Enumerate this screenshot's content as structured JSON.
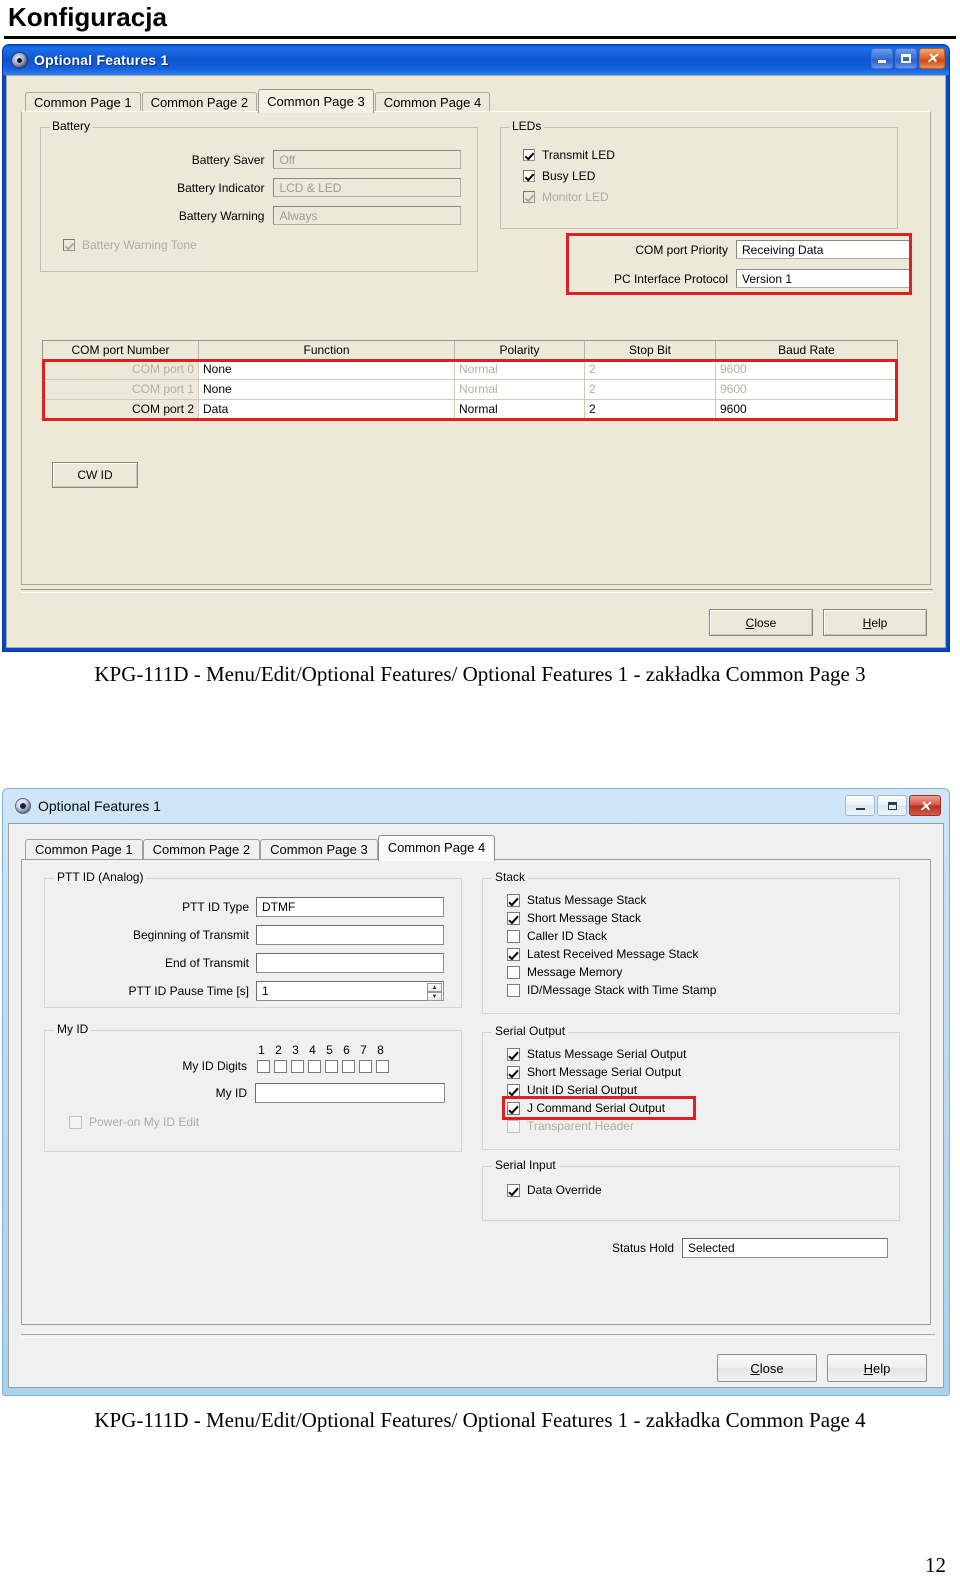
{
  "page": {
    "heading": "Konfiguracja",
    "page_number": "12",
    "caption_1": "KPG-111D - Menu/Edit/Optional Features/ Optional Features 1 - zakładka Common Page 3",
    "caption_2": "KPG-111D - Menu/Edit/Optional Features/ Optional Features 1 - zakładka Common Page 4",
    "highlight_color": "#e02020"
  },
  "window1": {
    "title": "Optional Features 1",
    "icon": "app-disc-icon",
    "controls": {
      "minimize": "–",
      "maximize": "□",
      "close": "✕"
    },
    "tabs": [
      {
        "label": "Common Page 1",
        "active": false
      },
      {
        "label": "Common Page 2",
        "active": false
      },
      {
        "label": "Common Page 3",
        "active": true
      },
      {
        "label": "Common Page 4",
        "active": false
      }
    ],
    "battery": {
      "legend": "Battery",
      "fields": [
        {
          "label": "Battery Saver",
          "value": "Off"
        },
        {
          "label": "Battery Indicator",
          "value": "LCD & LED"
        },
        {
          "label": "Battery Warning",
          "value": "Always"
        }
      ],
      "tone_checkbox": {
        "label": "Battery Warning Tone",
        "checked": true,
        "enabled": false
      }
    },
    "leds": {
      "legend": "LEDs",
      "items": [
        {
          "label": "Transmit LED",
          "checked": true,
          "enabled": true
        },
        {
          "label": "Busy LED",
          "checked": true,
          "enabled": true
        },
        {
          "label": "Monitor LED",
          "checked": true,
          "enabled": false
        }
      ]
    },
    "com_priority": {
      "fields": [
        {
          "label": "COM port Priority",
          "value": "Receiving Data"
        },
        {
          "label": "PC Interface Protocol",
          "value": "Version 1"
        }
      ]
    },
    "com_table": {
      "columns": [
        "COM port Number",
        "Function",
        "Polarity",
        "Stop Bit",
        "Baud Rate"
      ],
      "rows": [
        {
          "port": "COM port 0",
          "function": "None",
          "polarity": "Normal",
          "stop_bit": "2",
          "baud_rate": "9600",
          "enabled": false
        },
        {
          "port": "COM port 1",
          "function": "None",
          "polarity": "Normal",
          "stop_bit": "2",
          "baud_rate": "9600",
          "enabled": false
        },
        {
          "port": "COM port 2",
          "function": "Data",
          "polarity": "Normal",
          "stop_bit": "2",
          "baud_rate": "9600",
          "enabled": true
        }
      ]
    },
    "cw_id_button": "CW ID",
    "close_button": {
      "pre": "",
      "accel": "C",
      "post": "lose"
    },
    "help_button": {
      "pre": "",
      "accel": "H",
      "post": "elp"
    }
  },
  "window2": {
    "title": "Optional Features 1",
    "icon": "app-disc-icon",
    "controls": {
      "minimize": "–",
      "maximize": "□",
      "close": "✕"
    },
    "tabs": [
      {
        "label": "Common Page 1",
        "active": false
      },
      {
        "label": "Common Page 2",
        "active": false
      },
      {
        "label": "Common Page 3",
        "active": false
      },
      {
        "label": "Common Page 4",
        "active": true
      }
    ],
    "ptt_id": {
      "legend": "PTT ID (Analog)",
      "fields": [
        {
          "label": "PTT ID Type",
          "value": "DTMF"
        },
        {
          "label": "Beginning of Transmit",
          "value": ""
        },
        {
          "label": "End of Transmit",
          "value": ""
        },
        {
          "label": "PTT ID Pause Time [s]",
          "value": "1",
          "spinner": true
        }
      ]
    },
    "my_id": {
      "legend": "My ID",
      "digits_label": "My ID Digits",
      "digit_numbers": [
        "1",
        "2",
        "3",
        "4",
        "5",
        "6",
        "7",
        "8"
      ],
      "digit_checked": [
        false,
        false,
        false,
        false,
        false,
        false,
        false,
        false
      ],
      "my_id_label": "My ID",
      "my_id_value": "",
      "power_on_checkbox": {
        "label": "Power-on My ID Edit",
        "checked": false,
        "enabled": false
      }
    },
    "stack": {
      "legend": "Stack",
      "items": [
        {
          "label": "Status Message Stack",
          "checked": true,
          "enabled": true
        },
        {
          "label": "Short Message Stack",
          "checked": true,
          "enabled": true
        },
        {
          "label": "Caller ID Stack",
          "checked": false,
          "enabled": true
        },
        {
          "label": "Latest Received Message Stack",
          "checked": true,
          "enabled": true
        },
        {
          "label": "Message Memory",
          "checked": false,
          "enabled": true
        },
        {
          "label": "ID/Message Stack with Time Stamp",
          "checked": false,
          "enabled": true
        }
      ]
    },
    "serial_output": {
      "legend": "Serial Output",
      "items": [
        {
          "label": "Status Message Serial Output",
          "checked": true,
          "enabled": true,
          "highlighted": false
        },
        {
          "label": "Short Message Serial Output",
          "checked": true,
          "enabled": true,
          "highlighted": false
        },
        {
          "label": "Unit ID Serial Output",
          "checked": true,
          "enabled": true,
          "highlighted": false
        },
        {
          "label": "J Command Serial Output",
          "checked": true,
          "enabled": true,
          "highlighted": true
        },
        {
          "label": "Transparent Header",
          "checked": false,
          "enabled": false,
          "highlighted": false
        }
      ]
    },
    "serial_input": {
      "legend": "Serial Input",
      "items": [
        {
          "label": "Data Override",
          "checked": true,
          "enabled": true
        }
      ]
    },
    "status_hold": {
      "label": "Status Hold",
      "value": "Selected"
    },
    "close_button": {
      "accel": "C",
      "post": "lose"
    },
    "help_button": {
      "accel": "H",
      "post": "elp"
    }
  }
}
